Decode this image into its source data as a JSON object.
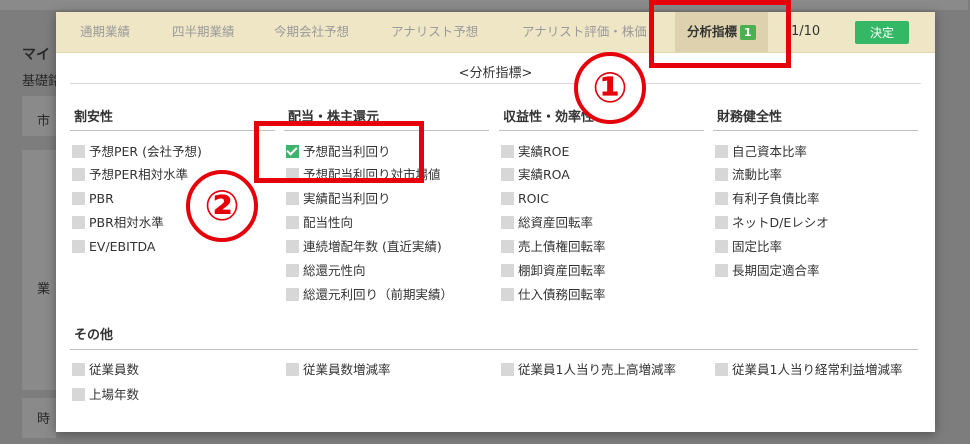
{
  "background": {
    "title": "マイ",
    "subtitle": "基礎銘",
    "item1": "市",
    "item2": "業",
    "item3": "時"
  },
  "tabs": [
    {
      "label": "通期業績"
    },
    {
      "label": "四半期業績"
    },
    {
      "label": "今期会社予想"
    },
    {
      "label": "アナリスト予想"
    },
    {
      "label": "アナリスト評価・株価"
    },
    {
      "label": "分析指標",
      "badge": "1"
    }
  ],
  "counter": "1/10",
  "decide_label": "決定",
  "subtitle": "<分析指標>",
  "groups": [
    {
      "title": "割安性",
      "items": [
        {
          "label": "予想PER (会社予想)",
          "checked": false
        },
        {
          "label": "予想PER相対水準",
          "checked": false
        },
        {
          "label": "PBR",
          "checked": false
        },
        {
          "label": "PBR相対水準",
          "checked": false
        },
        {
          "label": "EV/EBITDA",
          "checked": false
        }
      ]
    },
    {
      "title": "配当・株主還元",
      "items": [
        {
          "label": "予想配当利回り",
          "checked": true
        },
        {
          "label": "予想配当利回り対市場値",
          "checked": false
        },
        {
          "label": "実績配当利回り",
          "checked": false
        },
        {
          "label": "配当性向",
          "checked": false
        },
        {
          "label": "連続増配年数 (直近実績)",
          "checked": false
        },
        {
          "label": "総還元性向",
          "checked": false
        },
        {
          "label": "総還元利回り（前期実績）",
          "checked": false
        }
      ]
    },
    {
      "title": "収益性・効率性",
      "items": [
        {
          "label": "実績ROE",
          "checked": false
        },
        {
          "label": "実績ROA",
          "checked": false
        },
        {
          "label": "ROIC",
          "checked": false
        },
        {
          "label": "総資産回転率",
          "checked": false
        },
        {
          "label": "売上債権回転率",
          "checked": false
        },
        {
          "label": "棚卸資産回転率",
          "checked": false
        },
        {
          "label": "仕入債務回転率",
          "checked": false
        }
      ]
    },
    {
      "title": "財務健全性",
      "items": [
        {
          "label": "自己資本比率",
          "checked": false
        },
        {
          "label": "流動比率",
          "checked": false
        },
        {
          "label": "有利子負債比率",
          "checked": false
        },
        {
          "label": "ネットD/Eレシオ",
          "checked": false
        },
        {
          "label": "固定比率",
          "checked": false
        },
        {
          "label": "長期固定適合率",
          "checked": false
        }
      ]
    }
  ],
  "other": {
    "title": "その他",
    "items": [
      {
        "label": "従業員数",
        "checked": false
      },
      {
        "label": "従業員数増減率",
        "checked": false
      },
      {
        "label": "従業員1人当り売上高増減率",
        "checked": false
      },
      {
        "label": "従業員1人当り経常利益増減率",
        "checked": false
      },
      {
        "label": "上場年数",
        "checked": false
      }
    ]
  },
  "annotations": {
    "one": "①",
    "two": "②",
    "color": "#e6000a"
  },
  "colors": {
    "accent": "#34b865",
    "tabbar": "#efe6c6",
    "checked": "#3fb36b"
  }
}
